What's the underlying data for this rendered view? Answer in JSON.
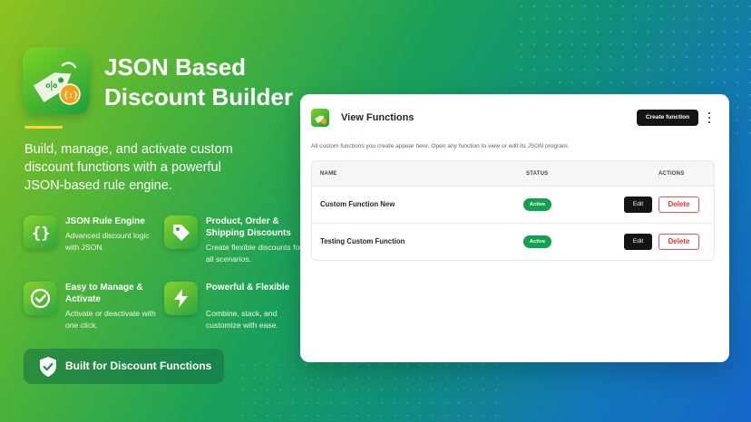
{
  "hero": {
    "title": "JSON Based Discount Builder",
    "subtitle": "Build, manage, and activate custom discount functions with a powerful JSON-based rule engine.",
    "accent_color": "#ffd43b"
  },
  "features": [
    {
      "icon": "braces-icon",
      "title": "JSON Rule Engine",
      "description": "Advanced discount logic with JSON."
    },
    {
      "icon": "tag-icon",
      "title": "Product, Order & Shipping Discounts",
      "description": "Create flexible discounts for all scenarios."
    },
    {
      "icon": "check-circle-icon",
      "title": "Easy to Manage & Activate",
      "description": "Activate or deactivate with one click."
    },
    {
      "icon": "lightning-icon",
      "title": "Powerful & Flexible",
      "description": "Combine, stack, and customize with ease."
    }
  ],
  "badge": {
    "icon": "shield-check-icon",
    "label": "Built for Discount Functions"
  },
  "panel": {
    "title": "View Functions",
    "create_label": "Create function",
    "description": "All custom functions you create appear here. Open any function to view or edit its JSON program.",
    "columns": [
      "NAME",
      "STATUS",
      "ACTIONS"
    ],
    "rows": [
      {
        "name": "Custom Function New",
        "status": "Active",
        "edit": "Edit",
        "delete": "Delete"
      },
      {
        "name": "Testing Custom Function",
        "status": "Active",
        "edit": "Edit",
        "delete": "Delete"
      }
    ],
    "status_color": "#12a150",
    "delete_color": "#e0343b"
  }
}
